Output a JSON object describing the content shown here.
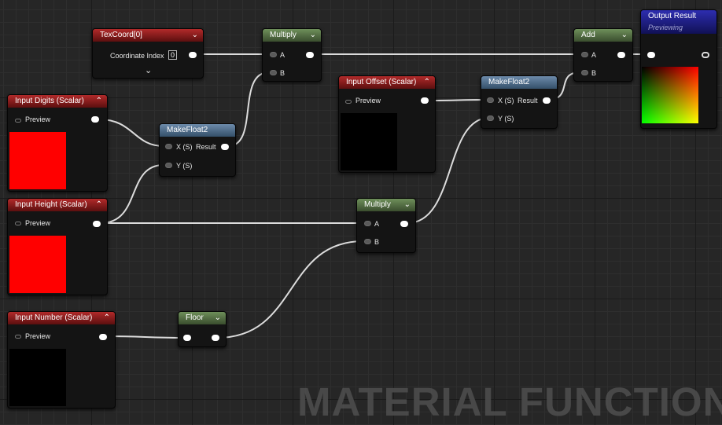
{
  "watermark": "MATERIAL FUNCTION",
  "colors": {
    "wire": "#dcdcdc",
    "input_header": "#8b1a1a",
    "math_header": "#5d7a4a",
    "makefloat_header": "#4f6e8f",
    "output_header": "#1f1f8f",
    "swatch_red": "#ff0000",
    "swatch_black": "#000000"
  },
  "nodes": {
    "texcoord": {
      "title": "TexCoord[0]",
      "field_label": "Coordinate Index",
      "field_value": "0"
    },
    "multiply_top": {
      "title": "Multiply",
      "pin_a": "A",
      "pin_b": "B"
    },
    "add": {
      "title": "Add",
      "pin_a": "A",
      "pin_b": "B"
    },
    "output": {
      "title": "Output Result",
      "status": "Previewing"
    },
    "input_digits": {
      "title": "Input Digits (Scalar)",
      "preview": "Preview",
      "swatch": "#ff0000"
    },
    "makefloat_left": {
      "title": "MakeFloat2",
      "pin_x": "X (S)",
      "pin_y": "Y (S)",
      "result": "Result"
    },
    "input_offset": {
      "title": "Input Offset (Scalar)",
      "preview": "Preview",
      "swatch": "#000000"
    },
    "makefloat_right": {
      "title": "MakeFloat2",
      "pin_x": "X (S)",
      "pin_y": "Y (S)",
      "result": "Result"
    },
    "input_height": {
      "title": "Input Height (Scalar)",
      "preview": "Preview",
      "swatch": "#ff0000"
    },
    "multiply_mid": {
      "title": "Multiply",
      "pin_a": "A",
      "pin_b": "B"
    },
    "input_number": {
      "title": "Input Number (Scalar)",
      "preview": "Preview",
      "swatch": "#000000"
    },
    "floor": {
      "title": "Floor"
    }
  }
}
